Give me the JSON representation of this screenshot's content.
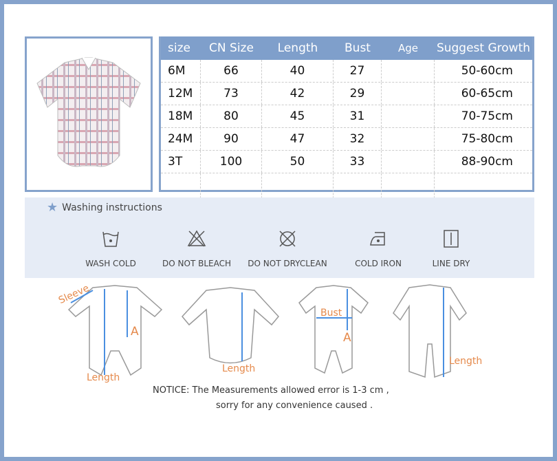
{
  "size_table": {
    "headers": [
      "size",
      "CN Size",
      "Length",
      "Bust",
      "Age",
      "Suggest Growth"
    ],
    "rows": [
      [
        "6M",
        "66",
        "40",
        "27",
        "",
        "50-60cm"
      ],
      [
        "12M",
        "73",
        "42",
        "29",
        "",
        "60-65cm"
      ],
      [
        "18M",
        "80",
        "45",
        "31",
        "",
        "70-75cm"
      ],
      [
        "24M",
        "90",
        "47",
        "32",
        "",
        "75-80cm"
      ],
      [
        "3T",
        "100",
        "50",
        "33",
        "",
        "88-90cm"
      ]
    ]
  },
  "washing": {
    "title": "Washing instructions",
    "items": [
      {
        "label": "WASH COLD",
        "icon": "wash-cold-icon"
      },
      {
        "label": "DO NOT BLEACH",
        "icon": "no-bleach-icon"
      },
      {
        "label": "DO NOT DRYCLEAN",
        "icon": "no-dryclean-icon"
      },
      {
        "label": "COLD IRON",
        "icon": "cold-iron-icon"
      },
      {
        "label": "LINE DRY",
        "icon": "line-dry-icon"
      }
    ]
  },
  "diagrams": {
    "sleeve": "Sleeve",
    "length": "Length",
    "a": "A",
    "bust": "Bust"
  },
  "notice": {
    "line1": "NOTICE:   The Measurements allowed error is 1-3 cm ,",
    "line2": "sorry for any convenience caused ."
  },
  "colors": {
    "accent": "#86a3cc",
    "measure": "#e58a4c",
    "line": "#4a8fe0"
  }
}
